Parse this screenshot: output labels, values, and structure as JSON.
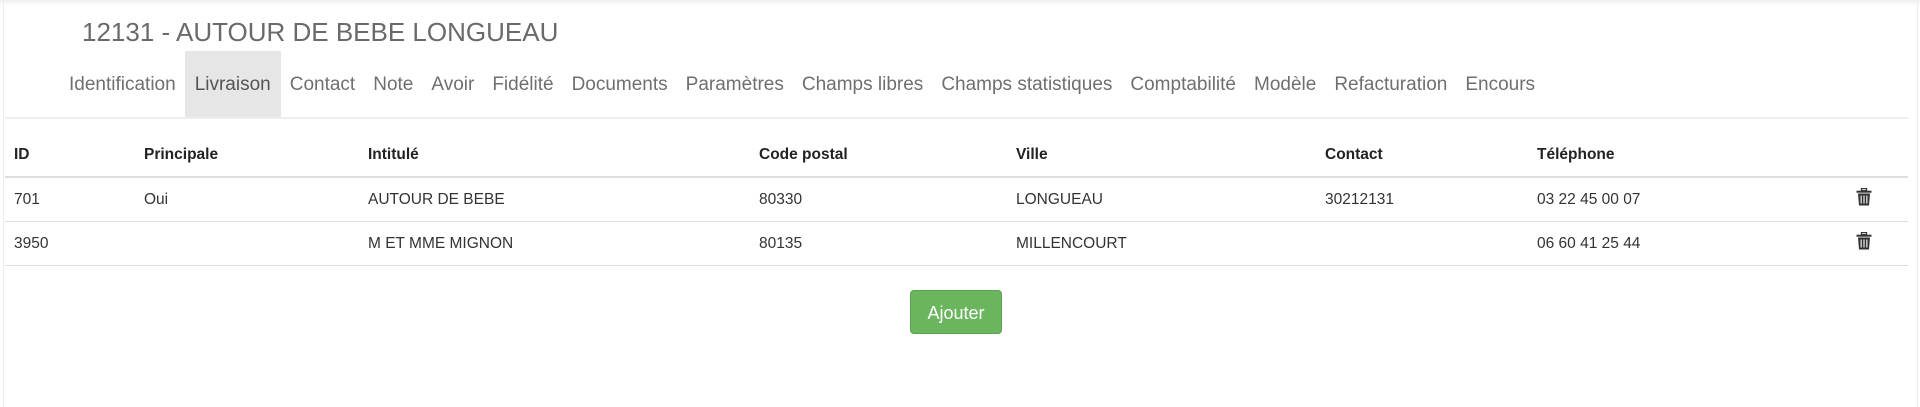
{
  "page": {
    "title": "12131 - AUTOUR DE BEBE LONGUEAU"
  },
  "tabs": [
    {
      "label": "Identification"
    },
    {
      "label": "Livraison",
      "active": true
    },
    {
      "label": "Contact"
    },
    {
      "label": "Note"
    },
    {
      "label": "Avoir"
    },
    {
      "label": "Fidélité"
    },
    {
      "label": "Documents"
    },
    {
      "label": "Paramètres"
    },
    {
      "label": "Champs libres"
    },
    {
      "label": "Champs statistiques"
    },
    {
      "label": "Comptabilité"
    },
    {
      "label": "Modèle"
    },
    {
      "label": "Refacturation"
    },
    {
      "label": "Encours"
    }
  ],
  "table": {
    "headers": {
      "id": "ID",
      "principale": "Principale",
      "intitule": "Intitulé",
      "code_postal": "Code postal",
      "ville": "Ville",
      "contact": "Contact",
      "telephone": "Téléphone"
    },
    "rows": [
      {
        "id": "701",
        "principale": "Oui",
        "intitule": "AUTOUR DE BEBE",
        "code_postal": "80330",
        "ville": "LONGUEAU",
        "contact": "30212131",
        "telephone": "03 22 45 00 07"
      },
      {
        "id": "3950",
        "principale": "",
        "intitule": "M ET MME MIGNON",
        "code_postal": "80135",
        "ville": "MILLENCOURT",
        "contact": "",
        "telephone": "06 60 41 25 44"
      }
    ],
    "row_action_icon": "trash-icon"
  },
  "actions": {
    "add_label": "Ajouter"
  },
  "colors": {
    "accent_button": "#6bb55e",
    "active_tab_bg": "#e6e6e6"
  }
}
